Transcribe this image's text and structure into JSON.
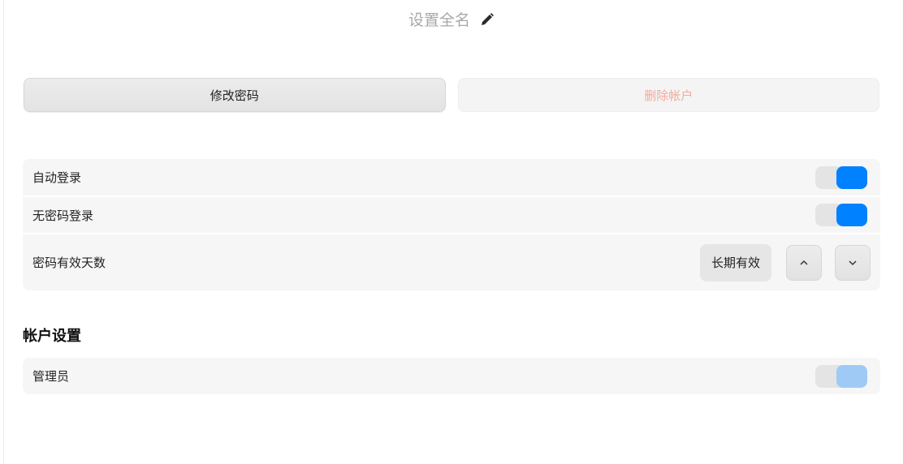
{
  "header": {
    "fullname_placeholder": "设置全名",
    "edit_icon": "pencil-icon"
  },
  "actions": {
    "change_password": "修改密码",
    "delete_account": "删除帐户"
  },
  "login_settings": {
    "auto_login": {
      "label": "自动登录",
      "enabled": true
    },
    "passwordless_login": {
      "label": "无密码登录",
      "enabled": true
    },
    "password_validity": {
      "label": "密码有效天数",
      "value": "长期有效",
      "up_icon": "chevron-up-icon",
      "down_icon": "chevron-down-icon"
    }
  },
  "account_settings": {
    "title": "帐户设置",
    "admin": {
      "label": "管理员",
      "enabled": true,
      "disabled": true
    }
  },
  "colors": {
    "accent": "#0081ff",
    "accent_disabled": "#9fcaf6",
    "danger_text": "#f5a99c"
  }
}
